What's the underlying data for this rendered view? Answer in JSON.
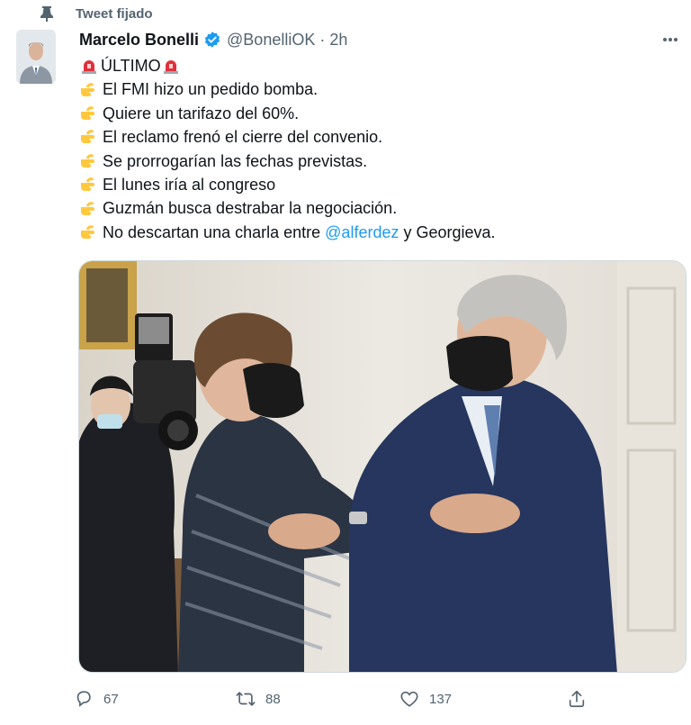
{
  "pinned": {
    "label": "Tweet fijado",
    "icon": "pin-icon"
  },
  "author": {
    "name": "Marcelo Bonelli",
    "handle": "@BonelliOK",
    "separator": "·",
    "time": "2h",
    "verified_color": "#1d9bf0"
  },
  "tweet": {
    "headline": {
      "text": "ÚLTIMO",
      "emoji": "rotating-light"
    },
    "lines": [
      {
        "emoji": "backhand-pointing-right",
        "text": "El FMI hizo un pedido bomba."
      },
      {
        "emoji": "backhand-pointing-right",
        "text": "Quiere un tarifazo del 60%."
      },
      {
        "emoji": "backhand-pointing-right",
        "text": "El reclamo frenó el cierre del convenio."
      },
      {
        "emoji": "backhand-pointing-right",
        "text": "Se prorrogarían las fechas previstas."
      },
      {
        "emoji": "backhand-pointing-right",
        "text": "El lunes iría al congreso"
      },
      {
        "emoji": "backhand-pointing-right",
        "text": "Guzmán busca destrabar la negociación."
      }
    ],
    "last_line": {
      "emoji": "backhand-pointing-right",
      "before": "No descartan una charla entre ",
      "mention": "@alferdez",
      "after": " y Georgieva."
    }
  },
  "actions": {
    "reply": {
      "icon": "reply-icon",
      "count": "67"
    },
    "retweet": {
      "icon": "retweet-icon",
      "count": "88"
    },
    "like": {
      "icon": "heart-icon",
      "count": "137"
    },
    "share": {
      "icon": "share-icon"
    }
  },
  "colors": {
    "secondary_text": "#536471",
    "link": "#1d9bf0",
    "text": "#0f1419"
  }
}
